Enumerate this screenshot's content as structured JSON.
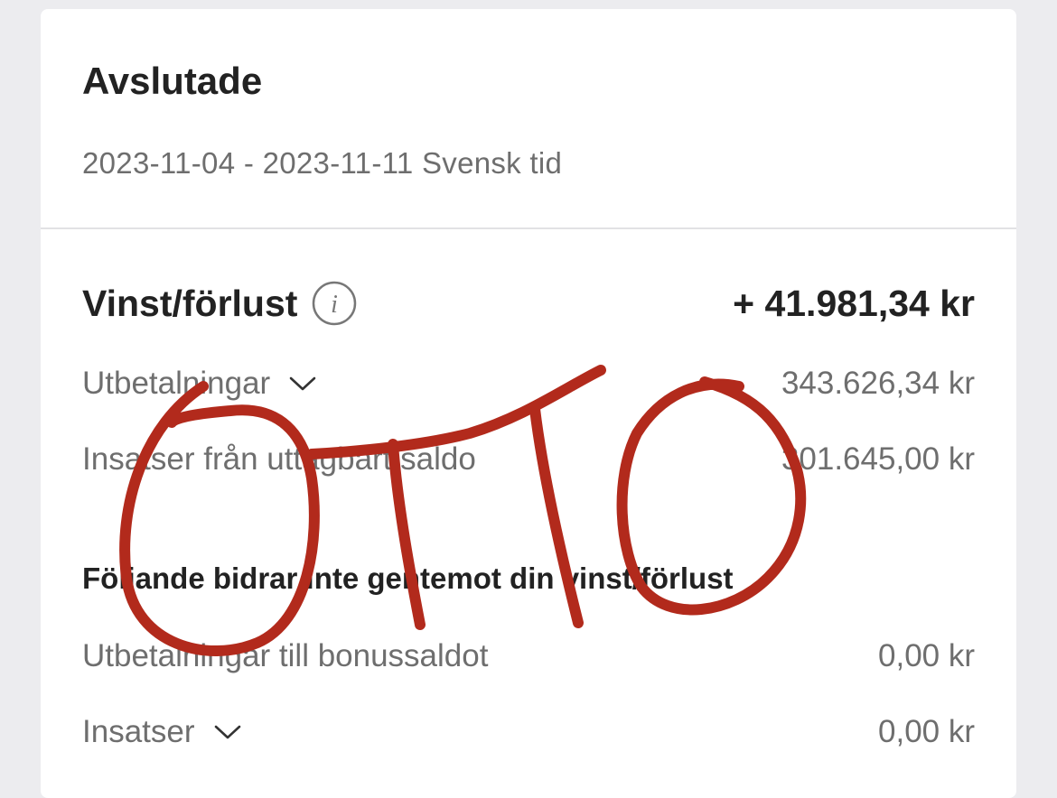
{
  "header": {
    "title": "Avslutade",
    "date_range": "2023-11-04 - 2023-11-11 Svensk tid"
  },
  "profit_loss": {
    "label": "Vinst/förlust",
    "value": "+ 41.981,34 kr",
    "info_icon": "info-icon"
  },
  "payouts": {
    "label": "Utbetalningar",
    "value": "343.626,34 kr",
    "icon": "chevron-down-icon"
  },
  "stakes_withdrawable": {
    "label": "Insatser från uttagbart saldo",
    "value": "301.645,00 kr"
  },
  "non_contributing": {
    "heading": "Följande bidrar inte gentemot din vinst/förlust",
    "bonus_payouts": {
      "label": "Utbetalningar till bonussaldot",
      "value": "0,00 kr"
    },
    "stakes": {
      "label": "Insatser",
      "value": "0,00 kr",
      "icon": "chevron-down-icon"
    }
  },
  "overlay": {
    "handwritten_text": "OTTO",
    "ink_color": "#b22a1c"
  },
  "colors": {
    "background": "#ececef",
    "card": "#ffffff",
    "primary_text": "#222222",
    "secondary_text": "#6e6e6e"
  }
}
